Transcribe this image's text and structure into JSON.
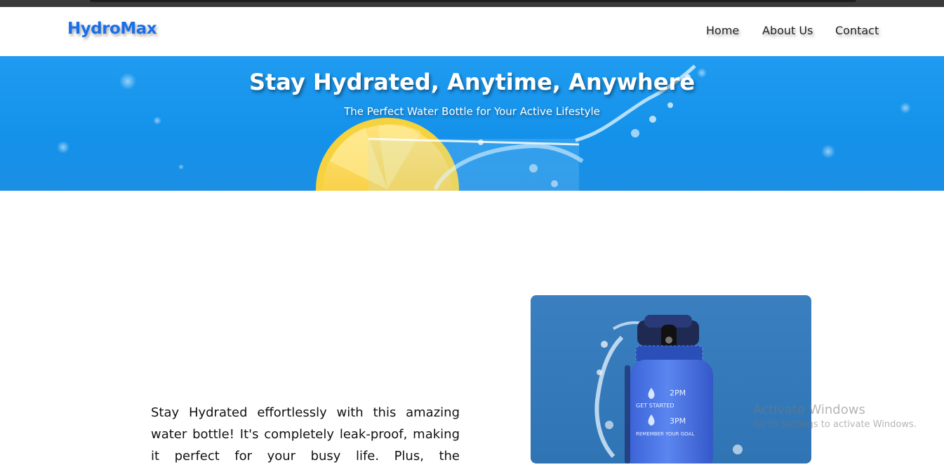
{
  "brand": {
    "name": "HydroMax",
    "color": "#1a6fe8"
  },
  "nav": {
    "items": [
      {
        "label": "Home"
      },
      {
        "label": "About Us"
      },
      {
        "label": "Contact"
      }
    ]
  },
  "hero": {
    "title": "Stay Hydrated, Anytime, Anywhere",
    "subtitle": "The Perfect Water Bottle for Your Active Lifestyle",
    "accent": "#1491ea"
  },
  "product": {
    "description": "Stay Hydrated effortlessly with this amazing water bottle! It's completely leak-proof, making it perfect for your busy life. Plus, the",
    "bottle_markings": [
      "2PM",
      "GET STARTED",
      "3PM",
      "REMEMBER YOUR GOAL"
    ]
  },
  "watermark": {
    "title": "Activate Windows",
    "subtitle": "Go to Settings to activate Windows."
  }
}
